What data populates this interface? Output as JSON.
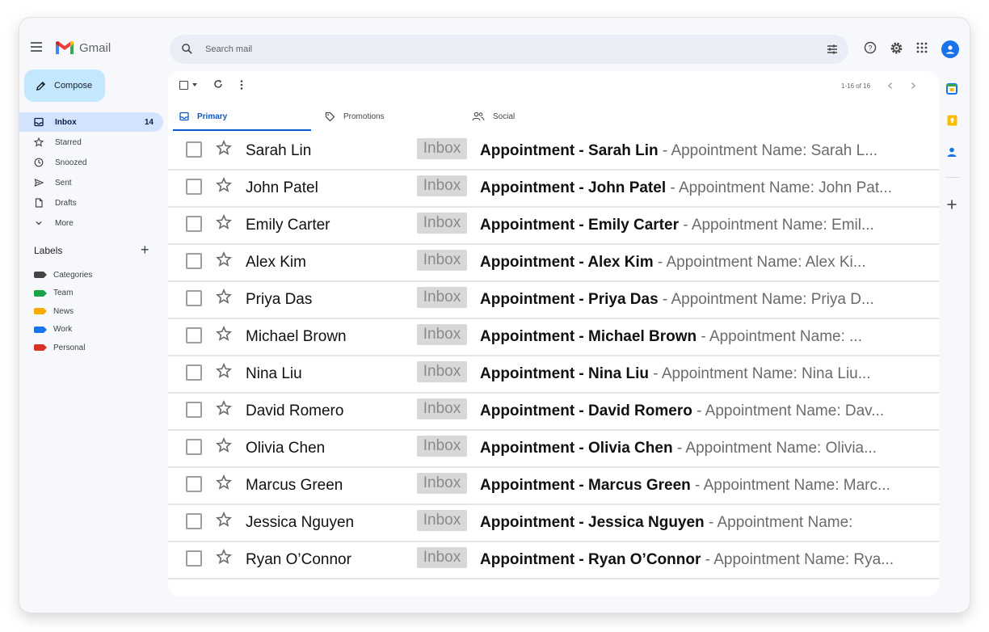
{
  "app": {
    "name": "Gmail"
  },
  "search": {
    "placeholder": "Search mail"
  },
  "sidebar": {
    "compose_label": "Compose",
    "items": [
      {
        "label": "Inbox",
        "count": "14",
        "icon": "inbox-icon",
        "active": true
      },
      {
        "label": "Starred",
        "count": "",
        "icon": "star-icon",
        "active": false
      },
      {
        "label": "Snoozed",
        "count": "",
        "icon": "clock-icon",
        "active": false
      },
      {
        "label": "Sent",
        "count": "",
        "icon": "send-icon",
        "active": false
      },
      {
        "label": "Drafts",
        "count": "",
        "icon": "draft-icon",
        "active": false
      },
      {
        "label": "More",
        "count": "",
        "icon": "chevron-down-icon",
        "active": false
      }
    ],
    "labels_title": "Labels",
    "labels": [
      {
        "name": "Categories",
        "color": "#444746"
      },
      {
        "name": "Team",
        "color": "#16a34a"
      },
      {
        "name": "News",
        "color": "#f9ab00"
      },
      {
        "name": "Work",
        "color": "#1a73e8"
      },
      {
        "name": "Personal",
        "color": "#d93025"
      }
    ]
  },
  "toolbar": {
    "pager": "1-16 of 16"
  },
  "tabs": [
    {
      "label": "Primary",
      "icon": "inbox-icon",
      "active": true
    },
    {
      "label": "Promotions",
      "icon": "tag-icon",
      "active": false
    },
    {
      "label": "Social",
      "icon": "people-icon",
      "active": false
    }
  ],
  "emails": [
    {
      "sender": "Sarah Lin",
      "badge": "Inbox",
      "subject": "Appointment - Sarah Lin",
      "snippet": " - Appointment Name: Sarah L..."
    },
    {
      "sender": "John Patel",
      "badge": "Inbox",
      "subject": "Appointment - John Patel",
      "snippet": " - Appointment Name: John Pat..."
    },
    {
      "sender": "Emily Carter",
      "badge": "Inbox",
      "subject": "Appointment - Emily Carter",
      "snippet": " - Appointment Name: Emil..."
    },
    {
      "sender": "Alex Kim",
      "badge": "Inbox",
      "subject": "Appointment - Alex Kim",
      "snippet": " - Appointment Name: Alex Ki..."
    },
    {
      "sender": "Priya Das",
      "badge": "Inbox",
      "subject": "Appointment - Priya Das",
      "snippet": " - Appointment Name: Priya D..."
    },
    {
      "sender": "Michael Brown",
      "badge": "Inbox",
      "subject": "Appointment - Michael Brown",
      "snippet": " - Appointment Name: ..."
    },
    {
      "sender": "Nina Liu",
      "badge": "Inbox",
      "subject": "Appointment - Nina Liu",
      "snippet": " - Appointment Name: Nina Liu..."
    },
    {
      "sender": "David Romero",
      "badge": "Inbox",
      "subject": "Appointment - David Romero",
      "snippet": " - Appointment Name: Dav..."
    },
    {
      "sender": "Olivia Chen",
      "badge": "Inbox",
      "subject": "Appointment - Olivia Chen",
      "snippet": " - Appointment Name: Olivia..."
    },
    {
      "sender": "Marcus Green",
      "badge": "Inbox",
      "subject": "Appointment - Marcus Green",
      "snippet": " - Appointment Name: Marc..."
    },
    {
      "sender": "Jessica Nguyen",
      "badge": "Inbox",
      "subject": "Appointment - Jessica Nguyen",
      "snippet": " - Appointment Name:"
    },
    {
      "sender": "Ryan O’Connor",
      "badge": "Inbox",
      "subject": "Appointment - Ryan O’Connor",
      "snippet": " - Appointment Name: Rya..."
    }
  ],
  "colors": {
    "accent": "#0b57d0",
    "compose_bg": "#c2e7ff",
    "active_nav": "#d3e3fd"
  }
}
